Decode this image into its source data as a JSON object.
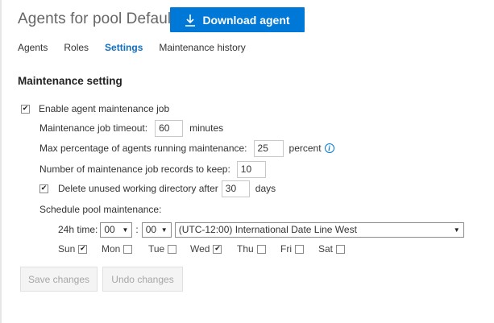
{
  "header": {
    "title": "Agents for pool Default",
    "download_label": "Download agent"
  },
  "tabs": [
    {
      "label": "Agents",
      "active": false
    },
    {
      "label": "Roles",
      "active": false
    },
    {
      "label": "Settings",
      "active": true
    },
    {
      "label": "Maintenance history",
      "active": false
    }
  ],
  "settings": {
    "section_title": "Maintenance setting",
    "enable_label": "Enable agent maintenance job",
    "enable_checked": true,
    "timeout": {
      "label": "Maintenance job timeout:",
      "value": "60",
      "unit": "minutes"
    },
    "max_percentage": {
      "label": "Max percentage of agents running maintenance:",
      "value": "25",
      "unit": "percent"
    },
    "records": {
      "label": "Number of maintenance job records to keep:",
      "value": "10"
    },
    "delete_dir": {
      "label": "Delete unused working directory after",
      "value": "30",
      "unit": "days",
      "checked": true
    },
    "schedule": {
      "label": "Schedule pool maintenance:",
      "time_label": "24h time:",
      "hour": "00",
      "separator": ":",
      "minute": "00",
      "timezone": "(UTC-12:00) International Date Line West",
      "days": [
        {
          "label": "Sun",
          "checked": true
        },
        {
          "label": "Mon",
          "checked": false
        },
        {
          "label": "Tue",
          "checked": false
        },
        {
          "label": "Wed",
          "checked": true
        },
        {
          "label": "Thu",
          "checked": false
        },
        {
          "label": "Fri",
          "checked": false
        },
        {
          "label": "Sat",
          "checked": false
        }
      ]
    }
  },
  "actions": {
    "save_label": "Save changes",
    "undo_label": "Undo changes"
  },
  "colors": {
    "accent": "#0078d7",
    "active_tab": "#106ebe"
  }
}
